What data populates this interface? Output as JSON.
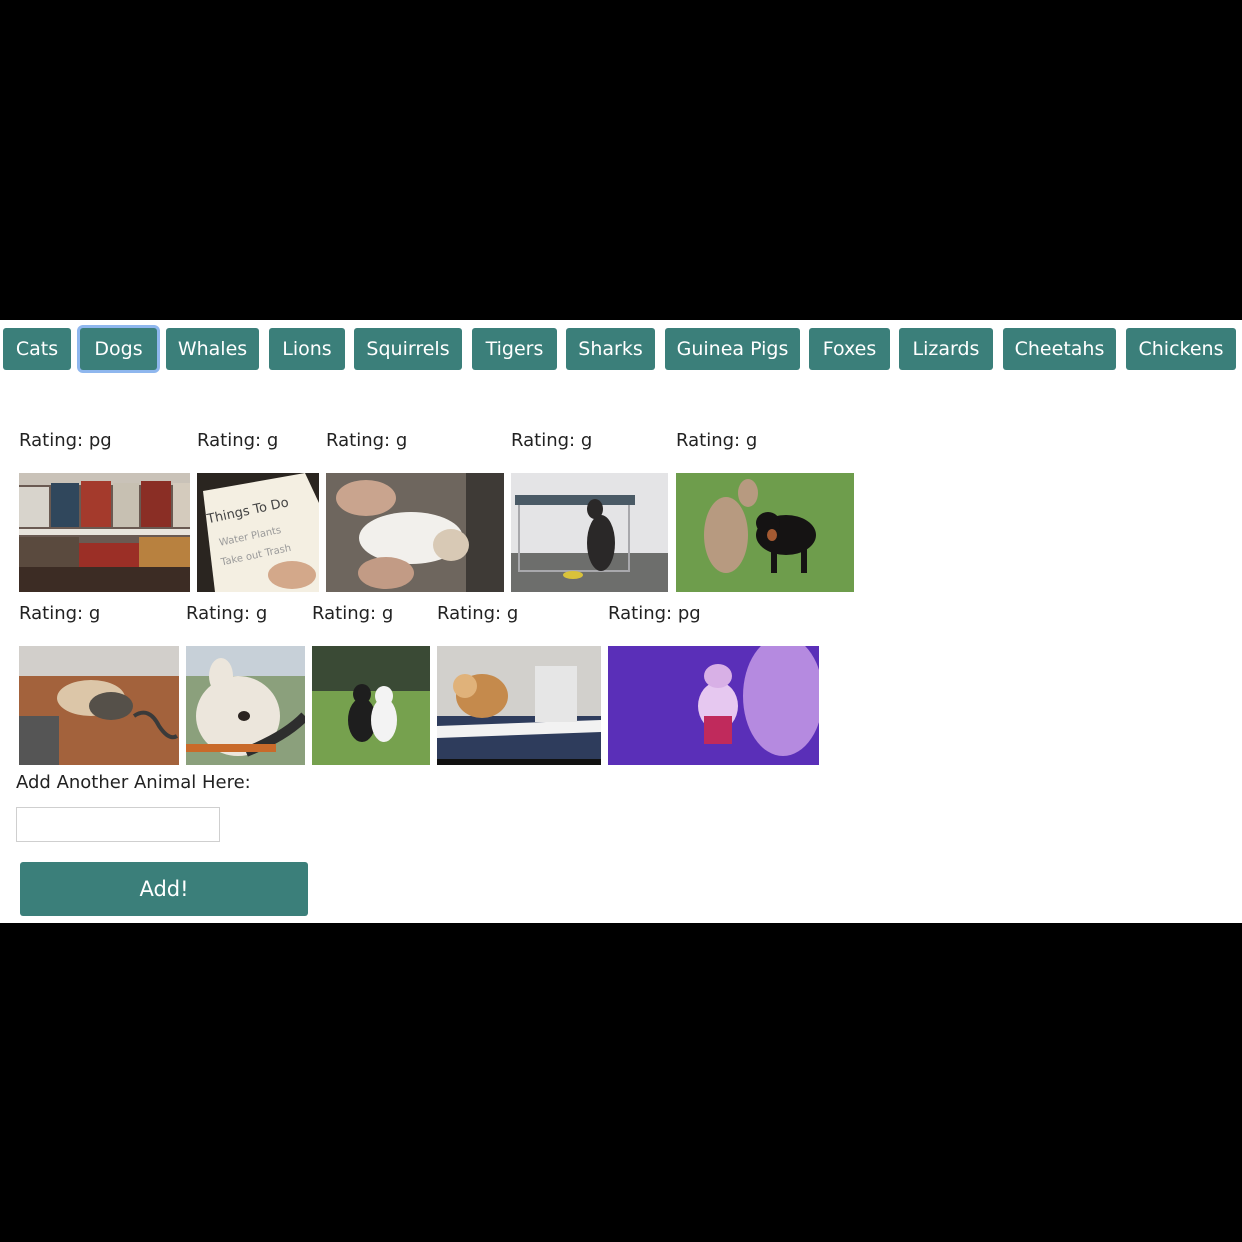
{
  "buttons": [
    "Cats",
    "Dogs",
    "Whales",
    "Lions",
    "Squirrels",
    "Tigers",
    "Sharks",
    "Guinea Pigs",
    "Foxes",
    "Lizards",
    "Cheetahs",
    "Chickens"
  ],
  "active_button": "Dogs",
  "gifs": [
    {
      "rating": "Rating: pg",
      "content": "dog-in-store-shelves"
    },
    {
      "rating": "Rating: g",
      "content": "things-to-do-note"
    },
    {
      "rating": "Rating: g",
      "content": "puppy-on-back"
    },
    {
      "rating": "Rating: g",
      "content": "dog-at-cage"
    },
    {
      "rating": "Rating: g",
      "content": "kangaroo-and-dog"
    },
    {
      "rating": "Rating: g",
      "content": "pug-on-floor"
    },
    {
      "rating": "Rating: g",
      "content": "bulldog-driving"
    },
    {
      "rating": "Rating: g",
      "content": "two-dogs-in-grass"
    },
    {
      "rating": "Rating: g",
      "content": "dog-with-laptop"
    },
    {
      "rating": "Rating: pg",
      "content": "dog-in-purple-light"
    }
  ],
  "form": {
    "label": "Add Another Animal Here:",
    "input_value": "",
    "input_placeholder": "",
    "submit_label": "Add!"
  },
  "colors": {
    "button_bg": "#3b7f7a",
    "button_text": "#ffffff",
    "active_ring": "#8fb7ee"
  }
}
